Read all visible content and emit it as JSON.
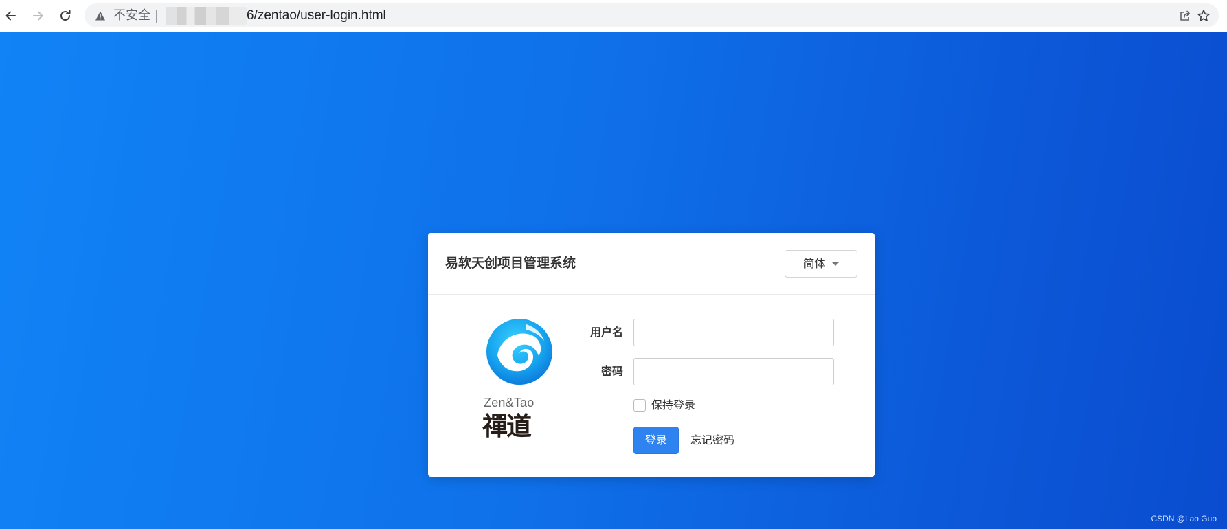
{
  "browser": {
    "security_label": "不安全",
    "separator": "|",
    "url_visible": "6/zentao/user-login.html"
  },
  "card": {
    "title": "易软天创项目管理系统",
    "language_selector": {
      "selected": "简体"
    },
    "logo": {
      "wordmark": "Zen&Tao",
      "chinese": "禪道"
    },
    "form": {
      "username_label": "用户名",
      "username_value": "",
      "password_label": "密码",
      "password_value": "",
      "keep_login_label": "保持登录",
      "keep_login_checked": false,
      "login_button": "登录",
      "forgot_password": "忘记密码"
    }
  },
  "watermark": "CSDN @Lao Guo",
  "colors": {
    "page_gradient_start": "#1183f6",
    "page_gradient_end": "#0a4ccf",
    "primary_button": "#2f83f1",
    "logo_blue": "#16a4ef"
  }
}
